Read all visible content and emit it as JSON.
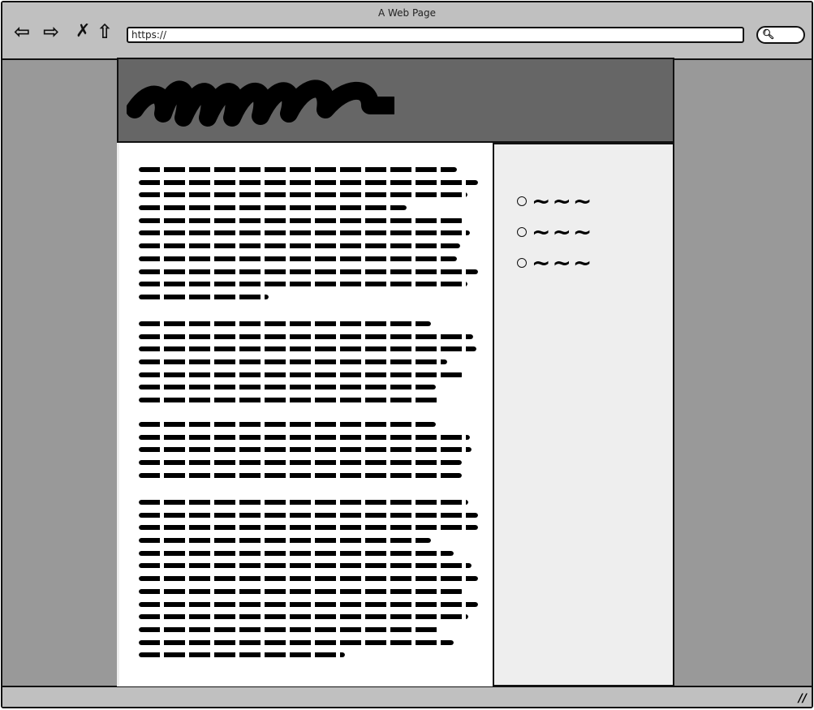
{
  "browser": {
    "title": "A Web Page",
    "url": "https://",
    "nav_icons": [
      "back-arrow-icon",
      "forward-arrow-icon",
      "close-x-icon",
      "home-icon"
    ],
    "search_icon": "search-icon"
  },
  "header": {
    "logo": "scribble-logo"
  },
  "content": {
    "paragraph_count": 4
  },
  "sidebar": {
    "items": [
      {
        "label": "~~~"
      },
      {
        "label": "~~~"
      },
      {
        "label": "~~~"
      }
    ]
  },
  "colors": {
    "chrome": "#c0c0c0",
    "background": "#999999",
    "header": "#666666",
    "sidebar": "#eeeeee"
  }
}
